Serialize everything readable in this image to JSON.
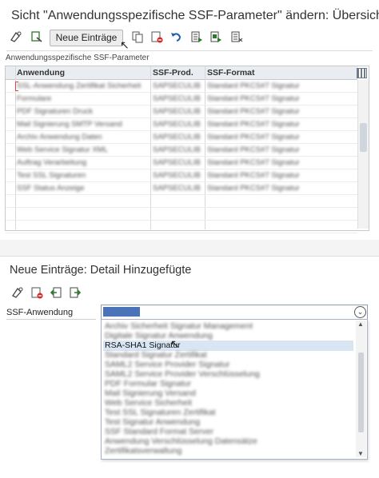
{
  "top": {
    "title": "Sicht \"Anwendungsspezifische SSF-Parameter\" ändern: Übersicht",
    "toolbar": {
      "neue_eintraege": "Neue Einträge",
      "icons": [
        "display-change-icon",
        "other-view-icon",
        "copy-icon",
        "delete-icon",
        "undo-icon",
        "select-all-icon",
        "select-block-icon",
        "deselect-all-icon"
      ]
    },
    "group_label": "Anwendungsspezifische SSF-Parameter",
    "table": {
      "columns": [
        "Anwendung",
        "SSF-Prod.",
        "SSF-Format"
      ],
      "rows": [
        [
          "SSL-Anwendung Zertifikat Sicherheit",
          "SAPSECULIB",
          "Standard PKCS#7 Signatur"
        ],
        [
          "Formulare",
          "SAPSECULIB",
          "Standard PKCS#7 Signatur"
        ],
        [
          "PDF Signaturen Druck",
          "SAPSECULIB",
          "Standard PKCS#7 Signatur"
        ],
        [
          "Mail Signierung SMTP Versand",
          "SAPSECULIB",
          "Standard PKCS#7 Signatur"
        ],
        [
          "Archiv Anwendung Daten",
          "SAPSECULIB",
          "Standard PKCS#7 Signatur"
        ],
        [
          "Web Service Signatur XML",
          "SAPSECULIB",
          "Standard PKCS#7 Signatur"
        ],
        [
          "Auftrag Verarbeitung",
          "SAPSECULIB",
          "Standard PKCS#7 Signatur"
        ],
        [
          "Test SSL Signaturen",
          "SAPSECULIB",
          "Standard PKCS#7 Signatur"
        ],
        [
          "SSF Status Anzeige",
          "SAPSECULIB",
          "Standard PKCS#7 Signatur"
        ]
      ]
    }
  },
  "bottom": {
    "title": "Neue Einträge: Detail Hinzugefügte",
    "toolbar_icons": [
      "display-change-icon",
      "delete-icon",
      "previous-entry-icon",
      "next-entry-icon"
    ],
    "field_label": "SSF-Anwendung",
    "dropdown": {
      "items": [
        "Archiv Sicherheit Signatur Management",
        "Digitale Signatur Anwendung",
        "RSA-SHA1 Signatur",
        "Standard Signatur Zertifikat",
        "SAML2 Service Provider Signatur",
        "SAML2 Service Provider Verschlüsselung",
        "PDF Formular Signatur",
        "Mail Signierung Versand",
        "Web Service Sicherheit",
        "Test SSL Signaturen Zertifikat",
        "Test Signatur Anwendung",
        "SSF Standard Format Server",
        "Anwendung Verschlüsselung Datensätze",
        "Zertifikatsverwaltung"
      ],
      "selected_index": 2
    }
  }
}
